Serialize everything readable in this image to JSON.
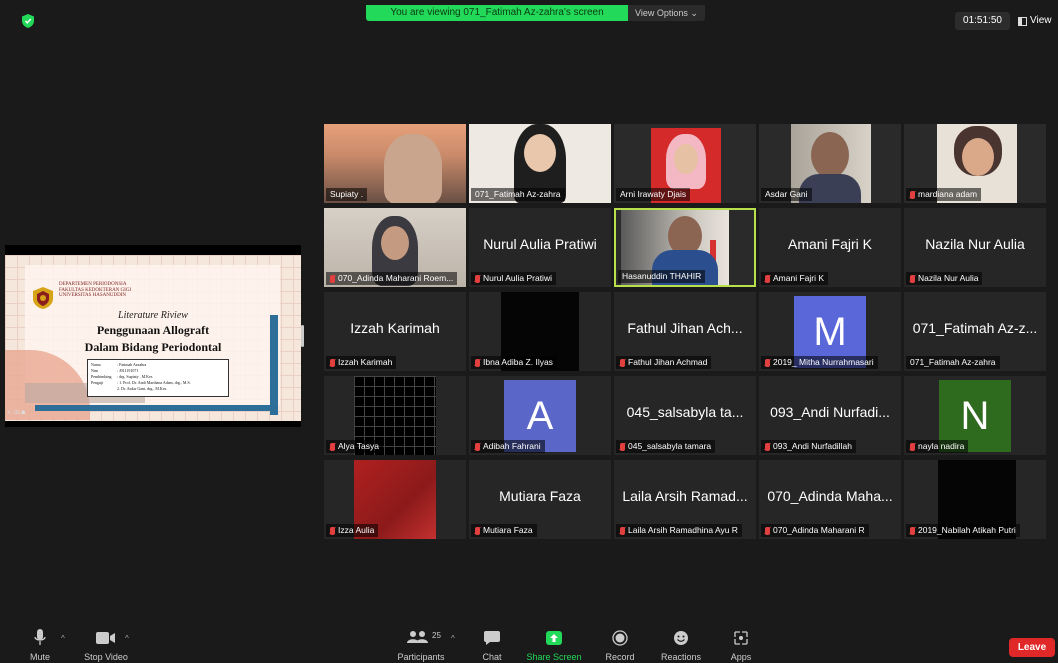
{
  "top": {
    "viewing_banner": "You are viewing 071_Fatimah Az-zahra's screen",
    "view_options": "View Options ⌄",
    "timer": "01:51:50",
    "view_button": "View"
  },
  "slide": {
    "dept_line1": "DEPARTEMEN PERIODONSIA",
    "dept_line2": "FAKULTAS KEDOKTERAN GIGI",
    "dept_line3": "UNIVERSITAS HASANUDDIN",
    "literature": "Literature Riview",
    "title1": "Penggunaan Allograft",
    "title2": "Dalam Bidang Periodontal",
    "info": [
      {
        "k": "Nama",
        "v": ": Fatimah Azzahra"
      },
      {
        "k": "Nim",
        "v": ": J011191071"
      },
      {
        "k": "Pembimbing",
        "v": ": drg. Supiaty , M.Kes"
      },
      {
        "k": "Penguji",
        "v": ": 1. Prof. Dr. Andi Mardiana Adam, drg., M.S."
      },
      {
        "k": "",
        "v": "  2. Dr. Asdar Gani, drg., M.Kes."
      }
    ]
  },
  "participants": [
    {
      "label": "Supiaty .",
      "muted": false,
      "kind": "video"
    },
    {
      "label": "071_Fatimah Az-zahra",
      "muted": false,
      "kind": "video"
    },
    {
      "label": "Arni Irawaty Djais",
      "muted": false,
      "kind": "video"
    },
    {
      "label": "Asdar Gani",
      "muted": false,
      "kind": "video"
    },
    {
      "label": "mardiana adam",
      "muted": true,
      "kind": "video"
    },
    {
      "label": "070_Adinda Maharani Roem...",
      "muted": true,
      "kind": "video"
    },
    {
      "label": "Nurul Aulia Pratiwi",
      "muted": true,
      "kind": "name",
      "big": "Nurul Aulia Pratiwi"
    },
    {
      "label": "Hasanuddin THAHIR",
      "muted": false,
      "kind": "video"
    },
    {
      "label": "Amani Fajri K",
      "muted": true,
      "kind": "name",
      "big": "Amani Fajri K"
    },
    {
      "label": "Nazila Nur Aulia",
      "muted": true,
      "kind": "name",
      "big": "Nazila Nur Aulia"
    },
    {
      "label": "Izzah Karimah",
      "muted": true,
      "kind": "name",
      "big": "Izzah Karimah"
    },
    {
      "label": "Ibna Adiba Z. Ilyas",
      "muted": true,
      "kind": "video"
    },
    {
      "label": "Fathul Jihan Achmad",
      "muted": true,
      "kind": "name",
      "big": "Fathul Jihan Ach..."
    },
    {
      "label": "2019_ Mitha Nurrahmasari",
      "muted": true,
      "kind": "avatar",
      "letter": "M"
    },
    {
      "label": "071_Fatimah Az-zahra",
      "muted": false,
      "kind": "name",
      "big": "071_Fatimah Az-z..."
    },
    {
      "label": "Alya Tasya",
      "muted": true,
      "kind": "video"
    },
    {
      "label": "Adibah Fahrani",
      "muted": true,
      "kind": "avatar",
      "letter": "A"
    },
    {
      "label": "045_salsabyla tamara",
      "muted": true,
      "kind": "name",
      "big": "045_salsabyla ta..."
    },
    {
      "label": "093_Andi Nurfadillah",
      "muted": true,
      "kind": "name",
      "big": "093_Andi Nurfadi..."
    },
    {
      "label": "nayla nadira",
      "muted": true,
      "kind": "avatar",
      "letter": "N"
    },
    {
      "label": "Izza Aulia",
      "muted": true,
      "kind": "video"
    },
    {
      "label": "Mutiara Faza",
      "muted": true,
      "kind": "name",
      "big": "Mutiara Faza"
    },
    {
      "label": "Laila Arsih Ramadhina Ayu R",
      "muted": true,
      "kind": "name",
      "big": "Laila Arsih Ramad..."
    },
    {
      "label": "070_Adinda Maharani R",
      "muted": true,
      "kind": "name",
      "big": "070_Adinda Maha..."
    },
    {
      "label": "2019_Nabilah Atikah Putri",
      "muted": true,
      "kind": "video"
    }
  ],
  "toolbar": {
    "mute": "Mute",
    "stop_video": "Stop Video",
    "participants": "Participants",
    "participants_count": "25",
    "chat": "Chat",
    "share_screen": "Share Screen",
    "record": "Record",
    "reactions": "Reactions",
    "apps": "Apps",
    "leave": "Leave"
  },
  "colors": {
    "share_green": "#23d959",
    "leave_red": "#e02828",
    "active_speaker": "#b8e04a",
    "avatar_m": "#5a67d8",
    "avatar_a": "#5a67c8",
    "avatar_n": "#2f6b1f"
  }
}
